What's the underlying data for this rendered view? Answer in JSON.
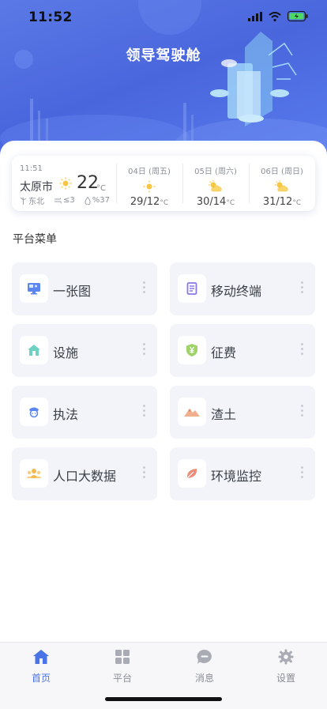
{
  "status": {
    "time": "11:52"
  },
  "header": {
    "title": "领导驾驶舱"
  },
  "weather": {
    "time": "11:51",
    "city": "太原市",
    "temp": "22",
    "unit": "°C",
    "wind_dir": "东北",
    "wind_level": "≤3",
    "humidity": "%37",
    "forecast": [
      {
        "date": "04日 (周五)",
        "temp": "29/12",
        "unit": "°C",
        "icon": "sun-icon"
      },
      {
        "date": "05日 (周六)",
        "temp": "30/14",
        "unit": "°C",
        "icon": "partly-cloudy-icon"
      },
      {
        "date": "06日 (周日)",
        "temp": "31/12",
        "unit": "°C",
        "icon": "partly-cloudy-icon"
      }
    ]
  },
  "menu": {
    "title": "平台菜单",
    "items": [
      {
        "label": "一张图",
        "icon": "map-screen-icon"
      },
      {
        "label": "移动终端",
        "icon": "document-icon"
      },
      {
        "label": "设施",
        "icon": "house-icon"
      },
      {
        "label": "征费",
        "icon": "yuan-shield-icon"
      },
      {
        "label": "执法",
        "icon": "officer-icon"
      },
      {
        "label": "渣土",
        "icon": "mountain-icon"
      },
      {
        "label": "人口大数据",
        "icon": "people-icon"
      },
      {
        "label": "环境监控",
        "icon": "leaf-icon"
      }
    ]
  },
  "tabs": [
    {
      "label": "首页",
      "icon": "home-icon",
      "active": true
    },
    {
      "label": "平台",
      "icon": "grid-icon",
      "active": false
    },
    {
      "label": "消息",
      "icon": "message-icon",
      "active": false
    },
    {
      "label": "设置",
      "icon": "gear-icon",
      "active": false
    }
  ],
  "colors": {
    "accent": "#4a73e8",
    "header": "#4f6be0",
    "tile_bg": "#f2f4f9"
  }
}
